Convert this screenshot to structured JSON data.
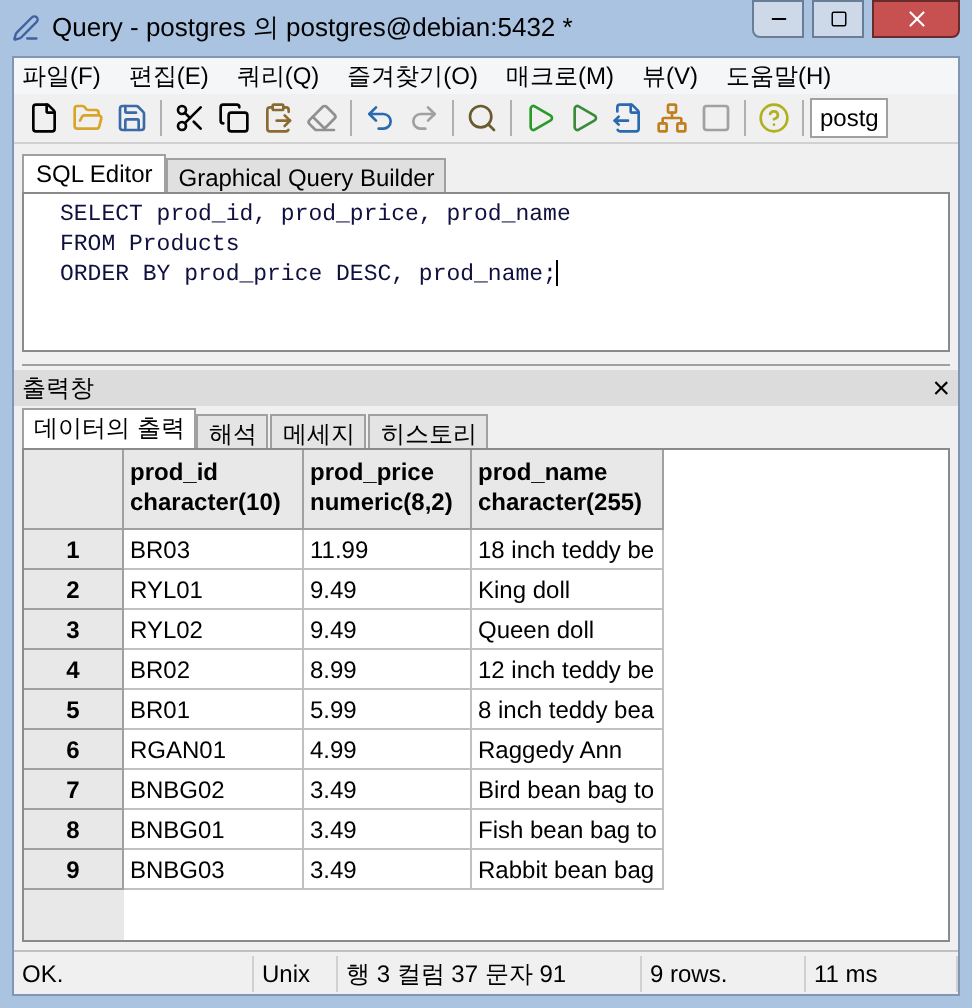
{
  "window": {
    "title": "Query - postgres 의 postgres@debian:5432 *"
  },
  "menu": [
    "파일(F)",
    "편집(E)",
    "쿼리(Q)",
    "즐겨찾기(O)",
    "매크로(M)",
    "뷰(V)",
    "도움말(H)"
  ],
  "toolbar": {
    "connection": "postg"
  },
  "editor_tabs": [
    {
      "label": "SQL Editor",
      "selected": true
    },
    {
      "label": "Graphical Query Builder",
      "selected": false
    }
  ],
  "editor": {
    "lines": [
      "SELECT prod_id, prod_price, prod_name",
      "FROM Products",
      "ORDER BY prod_price DESC, prod_name;"
    ]
  },
  "output": {
    "title": "출력창",
    "close": "×",
    "tabs": [
      {
        "label": "데이터의 출력",
        "selected": true
      },
      {
        "label": "해석",
        "selected": false
      },
      {
        "label": "메세지",
        "selected": false
      },
      {
        "label": "히스토리",
        "selected": false
      }
    ],
    "table": {
      "columns": [
        {
          "name": "prod_id",
          "type": "character(10)"
        },
        {
          "name": "prod_price",
          "type": "numeric(8,2)"
        },
        {
          "name": "prod_name",
          "type": "character(255)"
        }
      ],
      "rows": [
        {
          "number": "1",
          "cells": [
            "BR03",
            "11.99",
            "18 inch teddy be"
          ]
        },
        {
          "number": "2",
          "cells": [
            "RYL01",
            "9.49",
            "King doll"
          ]
        },
        {
          "number": "3",
          "cells": [
            "RYL02",
            "9.49",
            "Queen doll"
          ]
        },
        {
          "number": "4",
          "cells": [
            "BR02",
            "8.99",
            "12 inch teddy be"
          ]
        },
        {
          "number": "5",
          "cells": [
            "BR01",
            "5.99",
            "8 inch teddy bea"
          ]
        },
        {
          "number": "6",
          "cells": [
            "RGAN01",
            "4.99",
            "Raggedy Ann"
          ]
        },
        {
          "number": "7",
          "cells": [
            "BNBG02",
            "3.49",
            "Bird bean bag to"
          ]
        },
        {
          "number": "8",
          "cells": [
            "BNBG01",
            "3.49",
            "Fish bean bag to"
          ]
        },
        {
          "number": "9",
          "cells": [
            "BNBG03",
            "3.49",
            "Rabbit bean bag"
          ]
        }
      ]
    }
  },
  "status_bar": [
    "OK.",
    "Unix",
    "행 3 컬럼 37 문자 91",
    "9 rows.",
    "11 ms"
  ]
}
